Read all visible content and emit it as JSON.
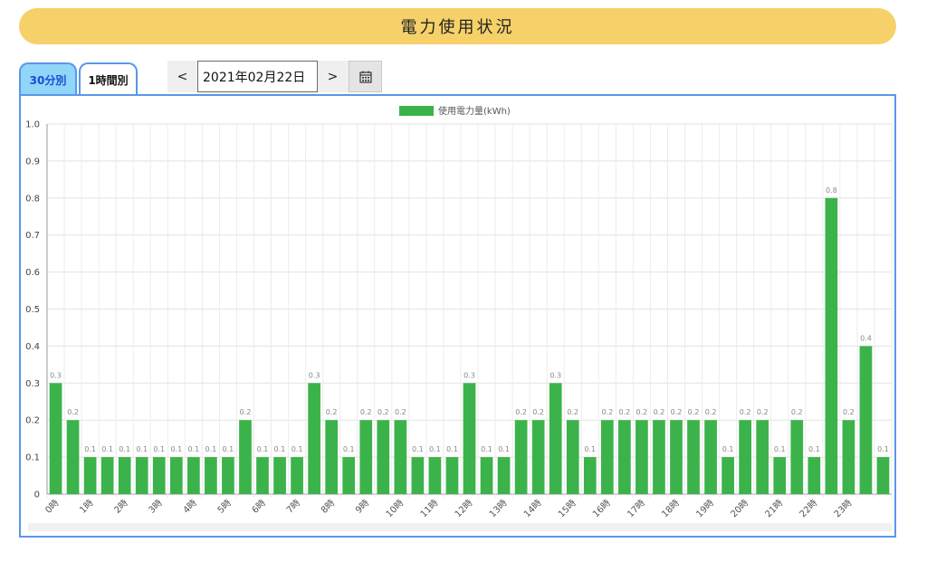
{
  "header": {
    "title": "電力使用状況"
  },
  "tabs": [
    {
      "label": "30分別",
      "active": true
    },
    {
      "label": "1時間別",
      "active": false
    }
  ],
  "date_nav": {
    "prev_label": "<",
    "next_label": ">",
    "date_value": "2021年02月22日",
    "calendar_icon": "calendar-icon"
  },
  "colors": {
    "title_bar": "#f6d169",
    "bar": "#3bb34a",
    "active_tab": "#8fd6f8",
    "frame": "#5a97e8"
  },
  "chart_data": {
    "type": "bar",
    "legend": "使用電力量(kWh)",
    "legend_position": "top-center",
    "grid": true,
    "ylim": [
      0,
      1.0
    ],
    "yticks": [
      "0",
      "0.1",
      "0.2",
      "0.3",
      "0.4",
      "0.5",
      "0.6",
      "0.7",
      "0.8",
      "0.9",
      "1.0"
    ],
    "xtick_labels": [
      "0時",
      "1時",
      "2時",
      "3時",
      "4時",
      "5時",
      "6時",
      "7時",
      "8時",
      "9時",
      "10時",
      "11時",
      "12時",
      "13時",
      "14時",
      "15時",
      "16時",
      "17時",
      "18時",
      "19時",
      "20時",
      "21時",
      "22時",
      "23時"
    ],
    "values": [
      0.3,
      0.2,
      0.1,
      0.1,
      0.1,
      0.1,
      0.1,
      0.1,
      0.1,
      0.1,
      0.1,
      0.2,
      0.1,
      0.1,
      0.1,
      0.3,
      0.2,
      0.1,
      0.2,
      0.2,
      0.2,
      0.1,
      0.1,
      0.1,
      0.3,
      0.1,
      0.1,
      0.2,
      0.2,
      0.3,
      0.2,
      0.1,
      0.2,
      0.2,
      0.2,
      0.2,
      0.2,
      0.2,
      0.2,
      0.1,
      0.2,
      0.2,
      0.1,
      0.2,
      0.1,
      0.8,
      0.2,
      0.4,
      0.1
    ],
    "value_labels": [
      "0.3",
      "0.2",
      "0.1",
      "0.1",
      "0.1",
      "0.1",
      "0.1",
      "0.1",
      "0.1",
      "0.1",
      "0.1",
      "0.2",
      "0.1",
      "0.1",
      "0.1",
      "0.3",
      "0.2",
      "0.1",
      "0.2",
      "0.2",
      "0.2",
      "0.1",
      "0.1",
      "0.1",
      "0.3",
      "0.1",
      "0.1",
      "0.2",
      "0.2",
      "0.3",
      "0.2",
      "0.1",
      "0.2",
      "0.2",
      "0.2",
      "0.2",
      "0.2",
      "0.2",
      "0.2",
      "0.1",
      "0.2",
      "0.2",
      "0.1",
      "0.2",
      "0.1",
      "0.8",
      "0.2",
      "0.4",
      "0.1"
    ]
  }
}
